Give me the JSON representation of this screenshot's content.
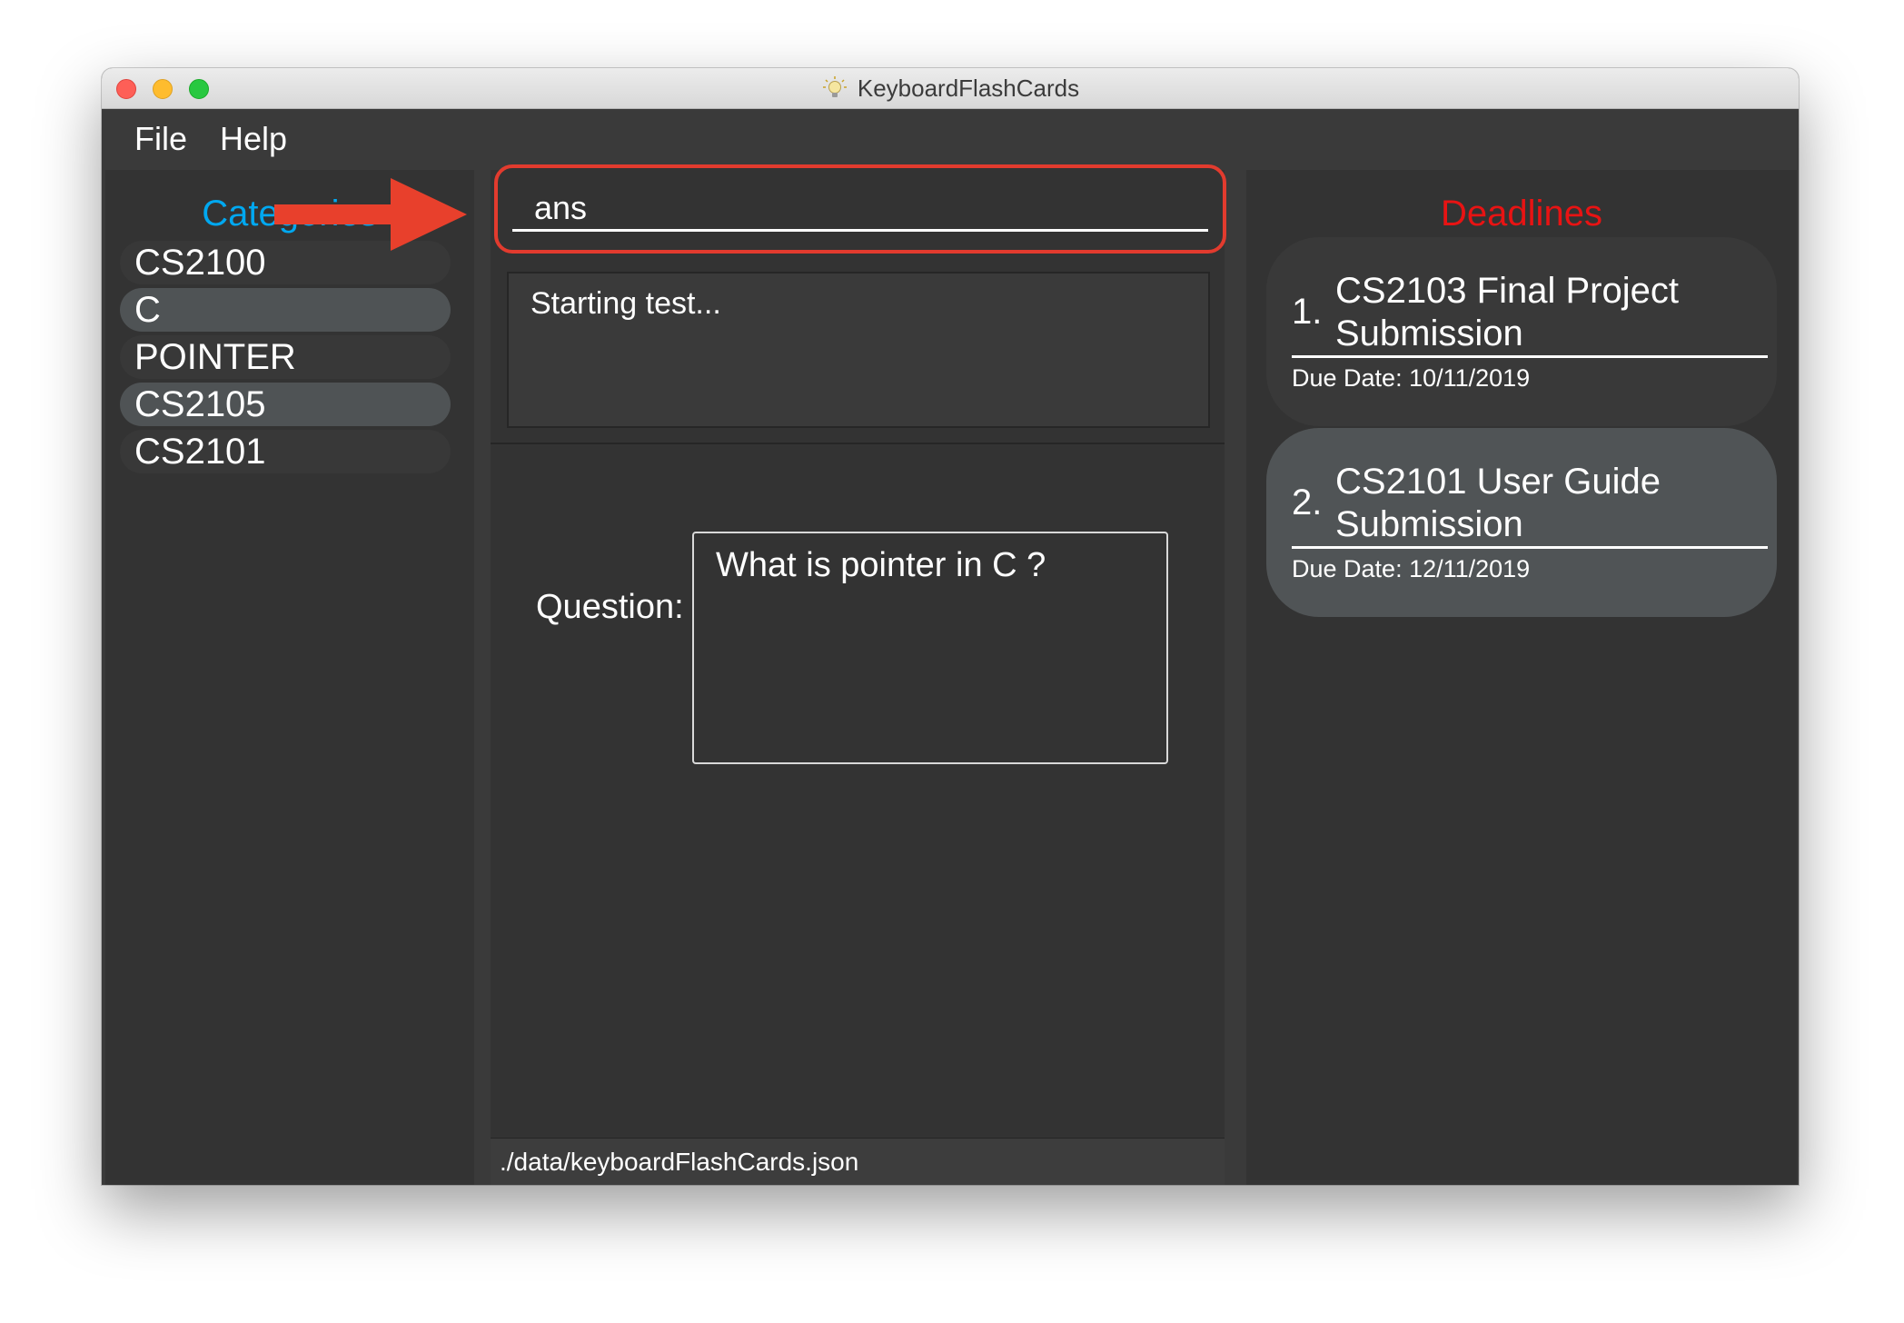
{
  "window": {
    "title": "KeyboardFlashCards",
    "title_icon": "lightbulb-icon"
  },
  "menu": {
    "file": "File",
    "help": "Help"
  },
  "categories": {
    "title": "Categories",
    "items": [
      {
        "label": "CS2100"
      },
      {
        "label": "C"
      },
      {
        "label": "POINTER"
      },
      {
        "label": "CS2105"
      },
      {
        "label": "CS2101"
      }
    ]
  },
  "command": {
    "value": "ans"
  },
  "result": {
    "text": "Starting test..."
  },
  "test": {
    "question_label": "Question:",
    "question_text": "What is pointer in C ?"
  },
  "status": {
    "path": "./data/keyboardFlashCards.json"
  },
  "deadlines": {
    "title": "Deadlines",
    "items": [
      {
        "index": "1.",
        "name": "CS2103 Final Project Submission",
        "due": "Due Date: 10/11/2019"
      },
      {
        "index": "2.",
        "name": "CS2101 User Guide Submission",
        "due": "Due Date: 12/11/2019"
      }
    ]
  },
  "colors": {
    "categories_title": "#00a8f0",
    "deadlines_title": "#e81313",
    "highlight": "#e23b2e"
  }
}
